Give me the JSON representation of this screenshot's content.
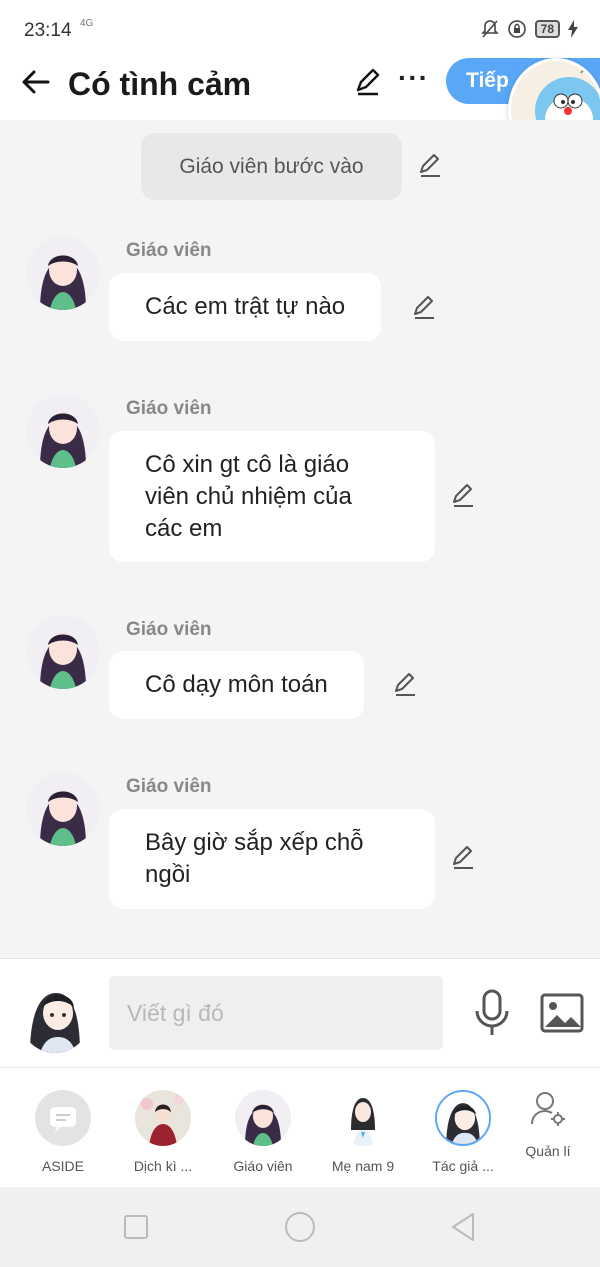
{
  "status_bar": {
    "time": "23:14",
    "network": "4G",
    "battery": "78"
  },
  "header": {
    "title": "Có tình cảm",
    "next_label": "Tiếp"
  },
  "sticker": {
    "text": "Doraemon"
  },
  "chat": {
    "system_message": "Giáo viên bước vào",
    "messages": [
      {
        "speaker": "Giáo viên",
        "lines": [
          "Các em trật tự nào"
        ]
      },
      {
        "speaker": "Giáo viên",
        "lines": [
          "Cô xin gt cô là giáo",
          "viên chủ nhiệm của",
          "các em"
        ]
      },
      {
        "speaker": "Giáo viên",
        "lines": [
          "Cô dạy môn toán"
        ]
      },
      {
        "speaker": "Giáo viên",
        "lines": [
          "Bây giờ sắp xếp chỗ",
          "ngồi"
        ]
      }
    ]
  },
  "input": {
    "placeholder": "Viết gì đó"
  },
  "characters": [
    {
      "name": "ASIDE",
      "icon": "chat-bubble-icon"
    },
    {
      "name": "Dịch kì ..."
    },
    {
      "name": "Giáo viên"
    },
    {
      "name": "Mẹ nam 9"
    },
    {
      "name": "Tác giả ..."
    }
  ],
  "manage_label": "Quản lí",
  "colors": {
    "accent": "#5aa6f7",
    "background": "#f4f4f4",
    "bubble": "#ffffff",
    "system_bubble": "#e8e8e8"
  }
}
